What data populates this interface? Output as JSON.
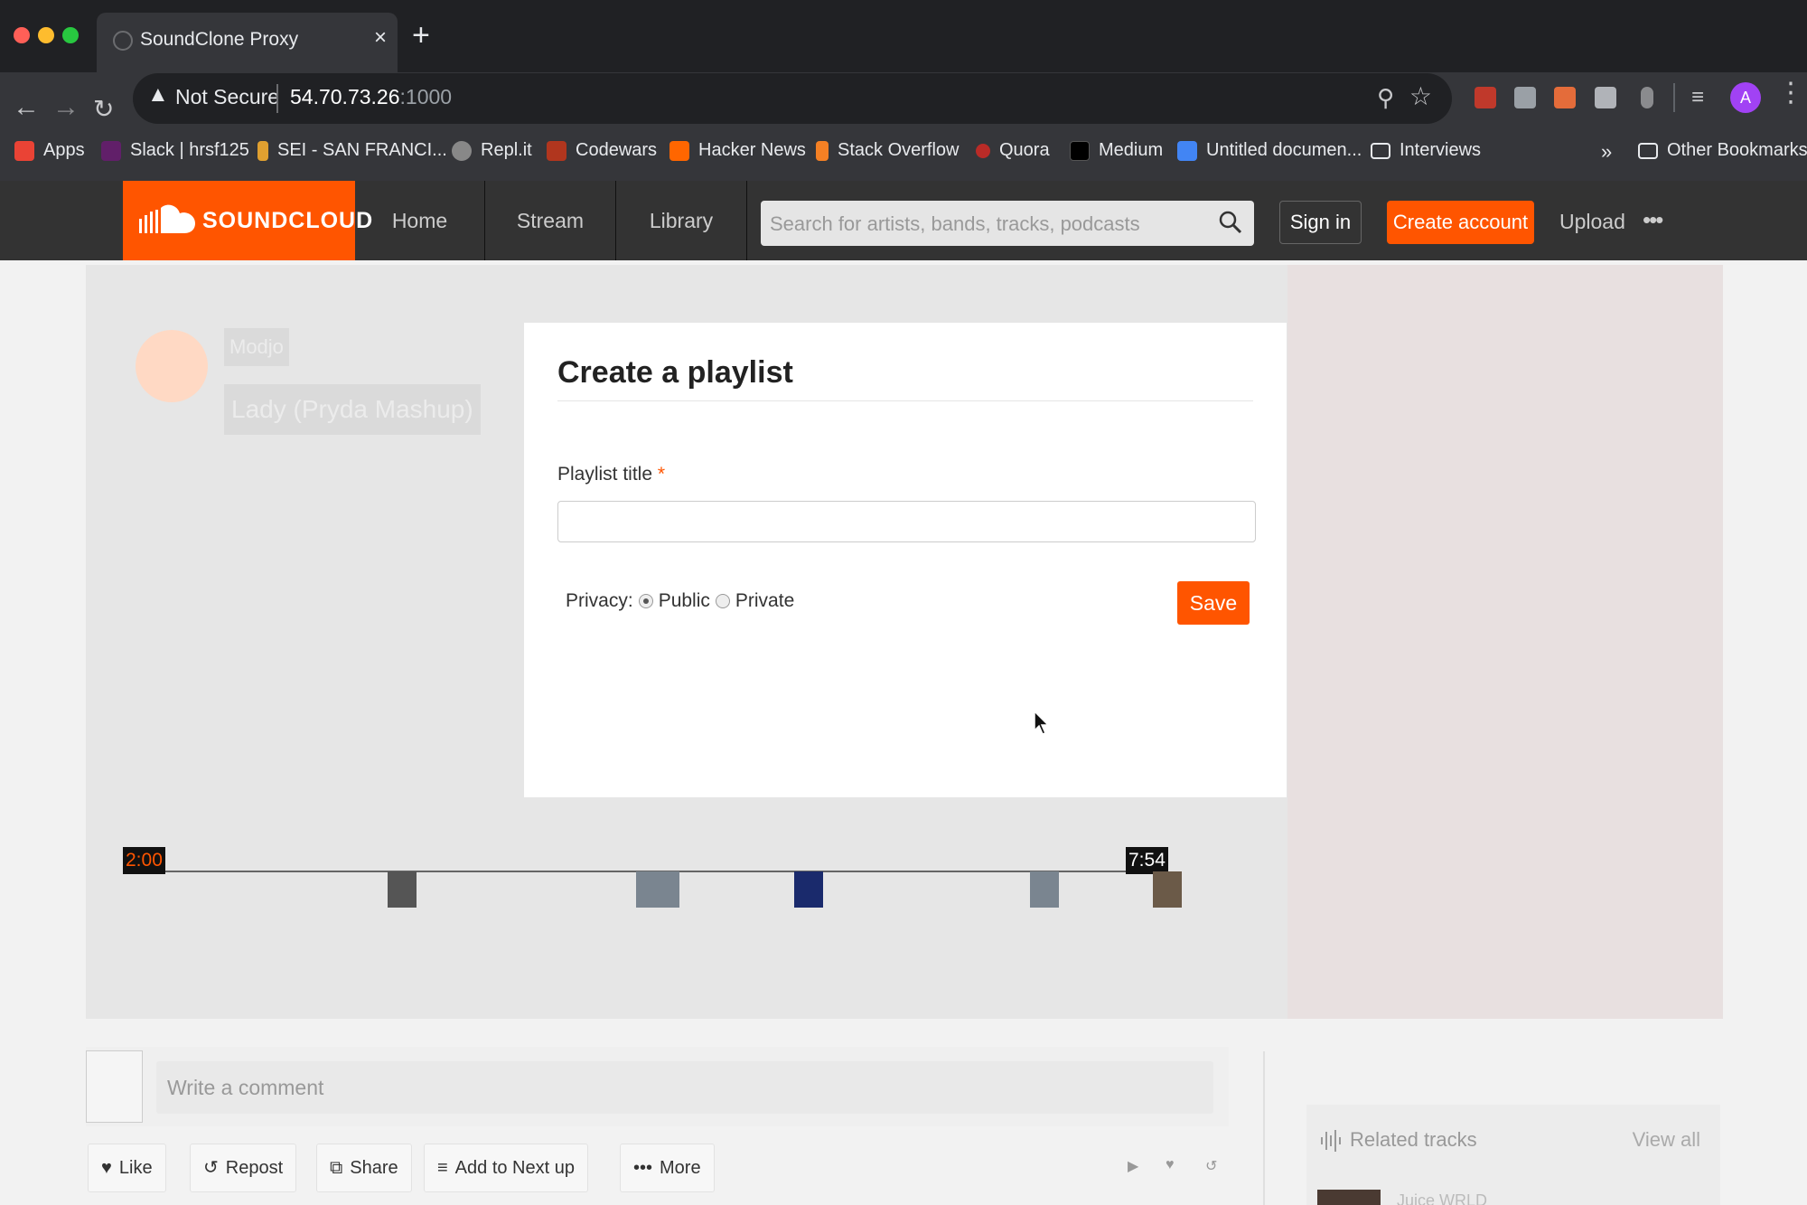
{
  "browser": {
    "tab_title": "SoundClone Proxy",
    "tab_close": "×",
    "new_tab": "+",
    "security_label": "Not Secure",
    "url_host": "54.70.73.26",
    "url_port": ":1000",
    "avatar_letter": "A",
    "bookmarks": [
      {
        "label": "Apps",
        "icon": "apps-grid-icon",
        "color": "#ea4335"
      },
      {
        "label": "Slack | hrsf125",
        "icon": "slack-icon",
        "color": "#611f69"
      },
      {
        "label": "SEI - SAN FRANCI...",
        "icon": "hand-icon",
        "color": "#e0a030"
      },
      {
        "label": "Repl.it",
        "icon": "replit-icon",
        "color": "#888888"
      },
      {
        "label": "Codewars",
        "icon": "codewars-icon",
        "color": "#b1361e"
      },
      {
        "label": "Hacker News",
        "icon": "hacker-news-icon",
        "color": "#ff6600"
      },
      {
        "label": "Stack Overflow",
        "icon": "stack-overflow-icon",
        "color": "#f48024"
      },
      {
        "label": "Quora",
        "icon": "quora-icon",
        "color": "#b92b27"
      },
      {
        "label": "Medium",
        "icon": "medium-icon",
        "color": "#000000"
      },
      {
        "label": "Untitled documen...",
        "icon": "google-docs-icon",
        "color": "#4285f4"
      },
      {
        "label": "Interviews",
        "icon": "folder-icon",
        "color": "#e8eaed"
      }
    ],
    "bookmarks_overflow": "»",
    "other_bookmarks": "Other Bookmarks"
  },
  "header": {
    "logo_text": "SOUNDCLOUD",
    "nav": [
      "Home",
      "Stream",
      "Library"
    ],
    "search_placeholder": "Search for artists, bands, tracks, podcasts",
    "sign_in": "Sign in",
    "create_account": "Create account",
    "upload": "Upload",
    "more": "•••",
    "accent_color": "#ff5500"
  },
  "track": {
    "artist": "Modjo",
    "title": "Lady (Pryda Mashup)",
    "time_start": "2:00",
    "time_end": "7:54"
  },
  "modal": {
    "title": "Create a playlist",
    "field_label": "Playlist title",
    "required_mark": "*",
    "input_value": "",
    "privacy_label": "Privacy:",
    "option_public": "Public",
    "option_private": "Private",
    "selected_privacy": "Public",
    "save": "Save"
  },
  "comment": {
    "placeholder": "Write a comment"
  },
  "actions": {
    "like": "Like",
    "repost": "Repost",
    "share": "Share",
    "add_next": "Add to Next up",
    "more": "More"
  },
  "related": {
    "title": "Related tracks",
    "view_all": "View all",
    "first_track_artist": "Juice WRLD"
  }
}
